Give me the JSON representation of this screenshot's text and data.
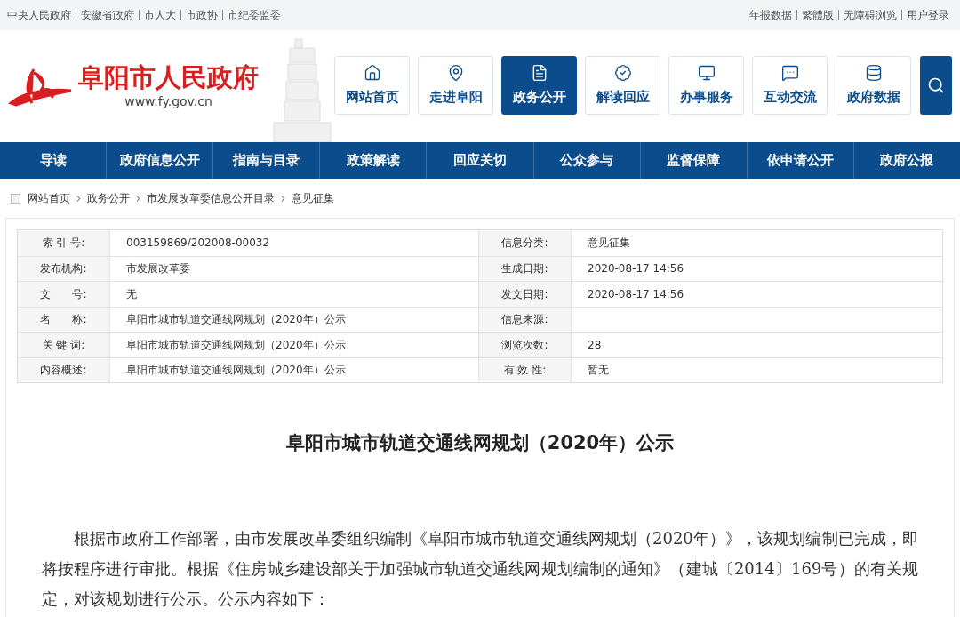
{
  "top_links_left": [
    "中央人民政府",
    "安徽省政府",
    "市人大",
    "市政协",
    "市纪委监委"
  ],
  "top_links_right": [
    "年报数据",
    "繁體版",
    "无障碍浏览",
    "用户登录"
  ],
  "logo": {
    "title": "阜阳市人民政府",
    "url": "www.fy.gov.cn"
  },
  "tiles": [
    {
      "kind": "home",
      "label": "网站首页",
      "selected": false
    },
    {
      "kind": "pin",
      "label": "走进阜阳",
      "selected": false
    },
    {
      "kind": "doc",
      "label": "政务公开",
      "selected": true
    },
    {
      "kind": "badge",
      "label": "解读回应",
      "selected": false
    },
    {
      "kind": "monitor",
      "label": "办事服务",
      "selected": false
    },
    {
      "kind": "chat",
      "label": "互动交流",
      "selected": false
    },
    {
      "kind": "data",
      "label": "政府数据",
      "selected": false
    }
  ],
  "nav": [
    "导读",
    "政府信息公开",
    "指南与目录",
    "政策解读",
    "回应关切",
    "公众参与",
    "监督保障",
    "依申请公开",
    "政府公报"
  ],
  "breadcrumb": [
    "网站首页",
    "政务公开",
    "市发展改革委信息公开目录",
    "意见征集"
  ],
  "info_table": [
    {
      "label": "索 引 号:",
      "value": "003159869/202008-00032",
      "label_2": "信息分类:",
      "value_2": "意见征集"
    },
    {
      "label": "发布机构:",
      "value": "市发展改革委",
      "label_2": "生成日期:",
      "value_2": "2020-08-17 14:56"
    },
    {
      "label": "文　　号:",
      "value": "无",
      "label_2": "发文日期:",
      "value_2": "2020-08-17 14:56"
    },
    {
      "label": "名　　称:",
      "value": "阜阳市城市轨道交通线网规划（2020年）公示",
      "label_2": "信息来源:"
    },
    {
      "label": "关 键 词:",
      "value": "阜阳市城市轨道交通线网规划（2020年）公示",
      "label_2": "浏览次数:",
      "value_2": "28"
    },
    {
      "label": "内容概述:",
      "value": "阜阳市城市轨道交通线网规划（2020年）公示",
      "label_2": "有 效 性:",
      "value_2": "暂无"
    }
  ],
  "article": {
    "title": "阜阳市城市轨道交通线网规划（2020年）公示",
    "paragraph": "根据市政府工作部署，由市发展改革委组织编制《阜阳市城市轨道交通线网规划（2020年）》，该规划编制已完成，即将按程序进行审批。根据《住房城乡建设部关于加强城市轨道交通线网规划编制的通知》（建城〔2014〕169号）的有关规定，对该规划进行公示。公示内容如下："
  }
}
